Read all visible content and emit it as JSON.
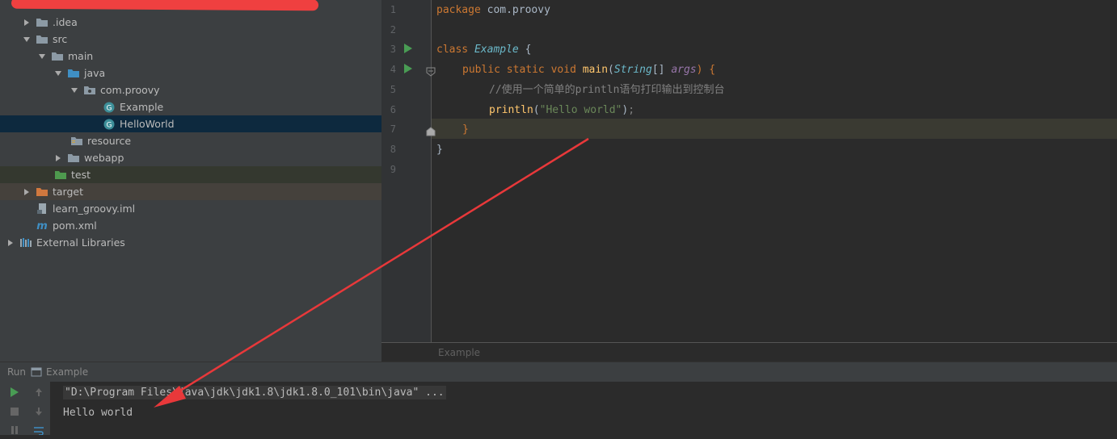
{
  "project_tree": {
    "items": [
      {
        "label": ".idea",
        "icon": "folder-icon"
      },
      {
        "label": "src",
        "icon": "folder-icon"
      },
      {
        "label": "main",
        "icon": "folder-icon"
      },
      {
        "label": "java",
        "icon": "source-folder-icon"
      },
      {
        "label": "com.proovy",
        "icon": "package-icon"
      },
      {
        "label": "Example",
        "icon": "groovy-class-icon"
      },
      {
        "label": "HelloWorld",
        "icon": "groovy-class-icon"
      },
      {
        "label": "resource",
        "icon": "resource-folder-icon"
      },
      {
        "label": "webapp",
        "icon": "folder-icon"
      },
      {
        "label": "test",
        "icon": "test-folder-icon"
      },
      {
        "label": "target",
        "icon": "excluded-folder-icon"
      },
      {
        "label": "learn_groovy.iml",
        "icon": "iml-file-icon"
      },
      {
        "label": "pom.xml",
        "icon": "maven-icon"
      },
      {
        "label": "External Libraries",
        "icon": "libraries-icon"
      }
    ]
  },
  "editor": {
    "line_numbers": [
      "1",
      "2",
      "3",
      "4",
      "5",
      "6",
      "7",
      "8",
      "9"
    ],
    "line1": {
      "kw": "package",
      "rest": " com.proovy"
    },
    "line3": {
      "kw": "class",
      "cls": "Example",
      "rest": " {"
    },
    "line4": {
      "kw1": "public",
      "kw2": "static",
      "kw3": "void",
      "fn": "main",
      "open": "(",
      "type": "String",
      "arr": "[] ",
      "arg": "args",
      "close": ") {"
    },
    "line5": {
      "comment": "//使用一个简单的println语句打印输出到控制台"
    },
    "line6": {
      "fn": "println",
      "open": "(",
      "str": "\"Hello world\"",
      "close": ")",
      "semi": ";"
    },
    "line7": {
      "brace": "}"
    },
    "line8": {
      "brace": "}"
    },
    "tab_label": "Example"
  },
  "run_panel": {
    "run_label": "Run",
    "config_name": "Example",
    "command_line": "\"D:\\Program Files\\java\\jdk\\jdk1.8\\jdk1.8.0_101\\bin\\java\" ...",
    "output": "Hello world"
  },
  "colors": {
    "accent_arrow": "#e8383a",
    "run_green": "#499c54"
  }
}
